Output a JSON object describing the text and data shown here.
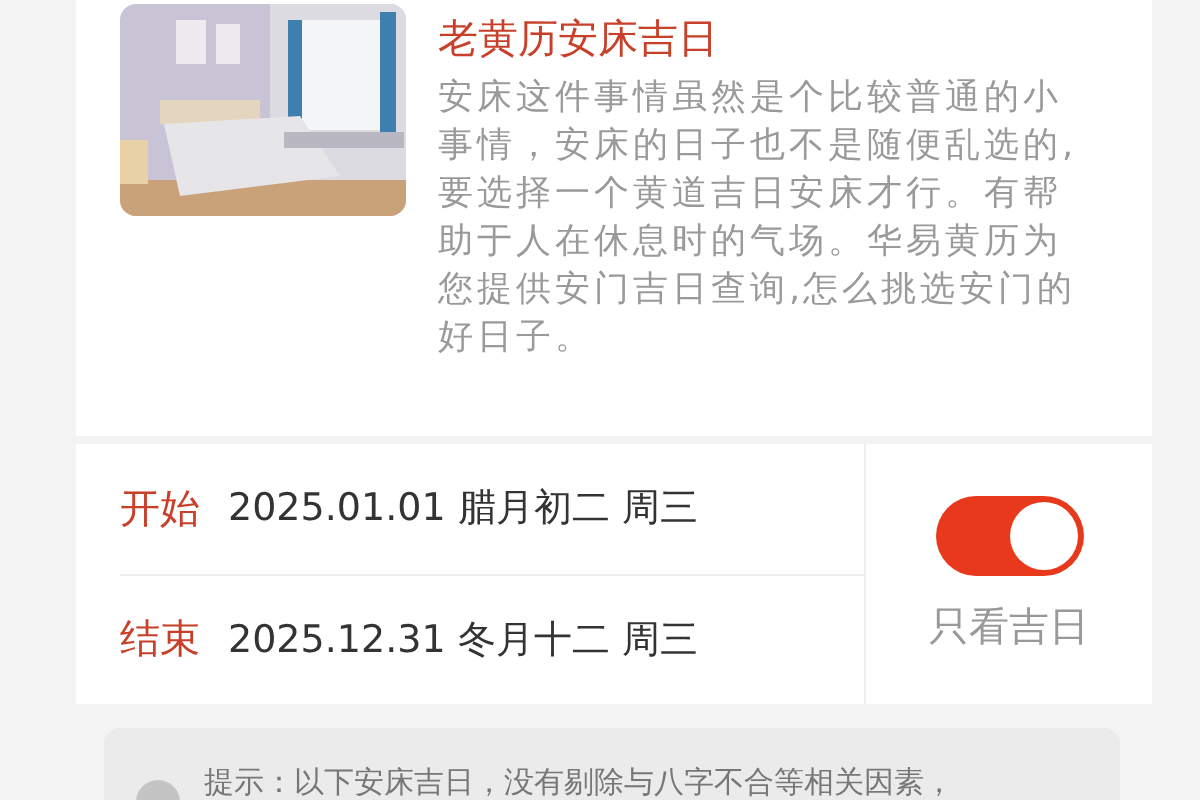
{
  "article": {
    "kind": "picture",
    "title": "老黄历安床吉日",
    "description": "安床这件事情虽然是个比较普通的小事情，安床的日子也不是随便乱选的,要选择一个黄道吉日安床才行。有帮助于人在休息时的气场。华易黄历为您提供安门吉日查询,怎么挑选安门的好日子。"
  },
  "range": [
    {
      "label": "开始",
      "date": "2025.01.01 腊月初二 周三"
    },
    {
      "label": "结束",
      "date": "2025.12.31 冬月十二 周三"
    }
  ],
  "filter": {
    "label": "只看吉日",
    "on": true
  },
  "tip": {
    "text": "提示：以下安床吉日，没有剔除与八字不合等相关因素，"
  }
}
